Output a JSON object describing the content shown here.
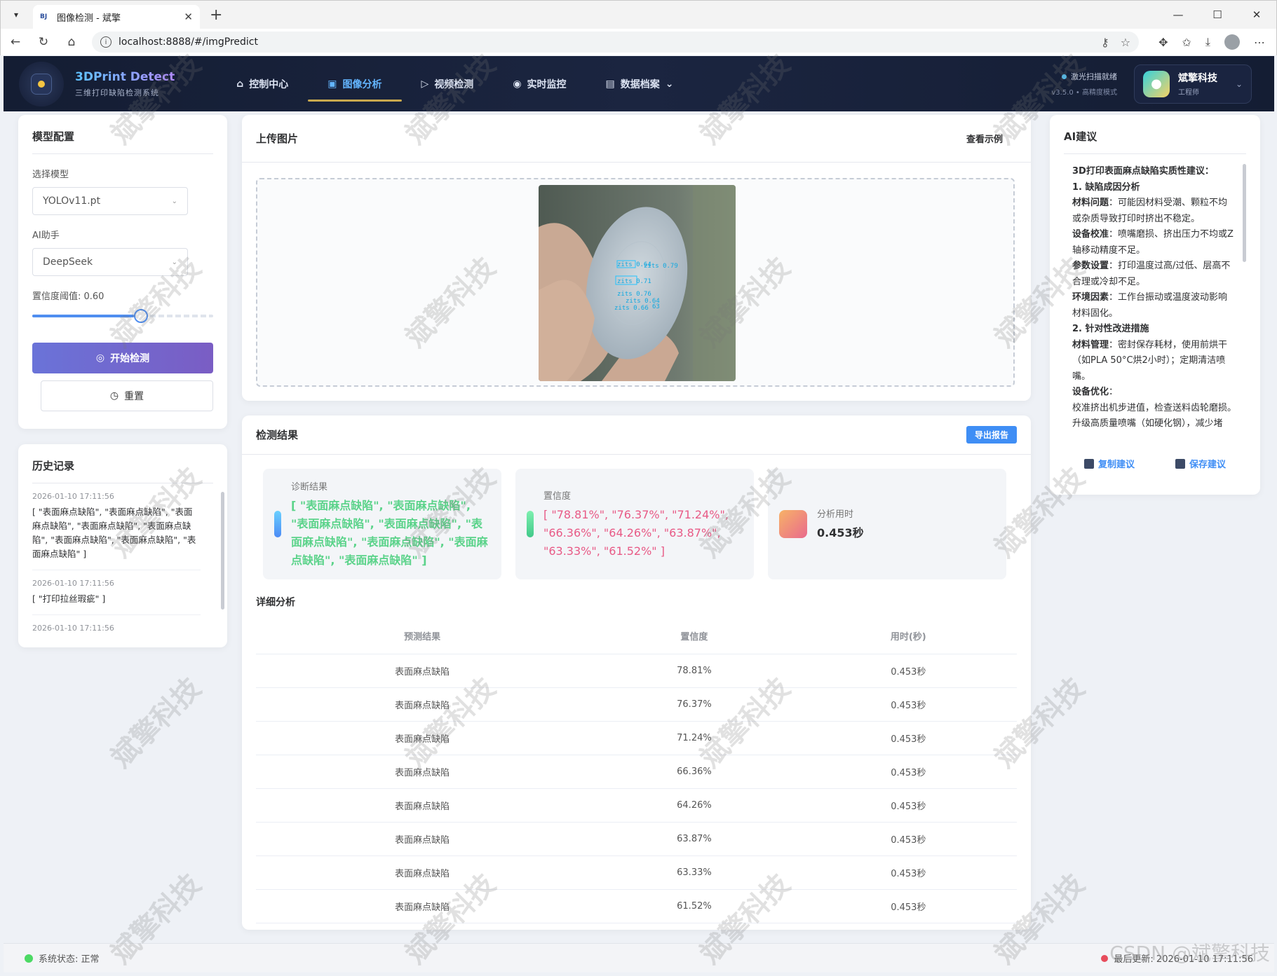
{
  "browser": {
    "tab_title": "图像检测 - 斌擎",
    "favicon": "BJ",
    "url": "localhost:8888/#/imgPredict"
  },
  "header": {
    "brand_title": "3DPrint Detect",
    "brand_sub": "三维打印缺陷检测系统",
    "nav": [
      {
        "label": "控制中心",
        "icon": "home-icon"
      },
      {
        "label": "图像分析",
        "icon": "image-icon",
        "active": true
      },
      {
        "label": "视频检测",
        "icon": "play-icon"
      },
      {
        "label": "实时监控",
        "icon": "camera-icon"
      },
      {
        "label": "数据档案",
        "icon": "document-icon"
      }
    ],
    "status_top": "激光扫描就绪",
    "status_sub": "v3.5.0 • 高精度模式",
    "user_name": "斌擎科技",
    "user_role": "工程师"
  },
  "config": {
    "title": "模型配置",
    "model_label": "选择模型",
    "model_value": "YOLOv11.pt",
    "ai_label": "AI助手",
    "ai_value": "DeepSeek",
    "threshold_label": "置信度阈值: 0.60",
    "threshold_value": 0.6,
    "start_label": "开始检测",
    "reset_label": "重置"
  },
  "history": {
    "title": "历史记录",
    "items": [
      {
        "time": "2026-01-10 17:11:56",
        "text": "[ \"表面麻点缺陷\", \"表面麻点缺陷\", \"表面麻点缺陷\", \"表面麻点缺陷\", \"表面麻点缺陷\", \"表面麻点缺陷\", \"表面麻点缺陷\", \"表面麻点缺陷\" ]"
      },
      {
        "time": "2026-01-10 17:11:56",
        "text": "[ \"打印拉丝瑕疵\" ]"
      },
      {
        "time": "2026-01-10 17:11:56",
        "text": ""
      }
    ]
  },
  "upload": {
    "title": "上传图片",
    "example_link": "查看示例",
    "detections": [
      {
        "label": "zits 0.64"
      },
      {
        "label": "zits 0.79"
      },
      {
        "label": "zits 0.71"
      },
      {
        "label": "zits 0.76"
      },
      {
        "label": "zits 0.64"
      },
      {
        "label": "zits 0.66"
      },
      {
        "label": "63"
      }
    ]
  },
  "results": {
    "title": "检测结果",
    "export_label": "导出报告",
    "diagnosis_label": "诊断结果",
    "diagnosis_value": "[ \"表面麻点缺陷\", \"表面麻点缺陷\", \"表面麻点缺陷\", \"表面麻点缺陷\", \"表面麻点缺陷\", \"表面麻点缺陷\", \"表面麻点缺陷\", \"表面麻点缺陷\" ]",
    "confidence_label": "置信度",
    "confidence_value": "[ \"78.81%\", \"76.37%\", \"71.24%\", \"66.36%\", \"64.26%\", \"63.87%\", \"63.33%\", \"61.52%\" ]",
    "time_label": "分析用时",
    "time_value": "0.453秒",
    "detail_title": "详细分析",
    "columns": [
      "预测结果",
      "置信度",
      "用时(秒)"
    ],
    "rows": [
      [
        "表面麻点缺陷",
        "78.81%",
        "0.453秒"
      ],
      [
        "表面麻点缺陷",
        "76.37%",
        "0.453秒"
      ],
      [
        "表面麻点缺陷",
        "71.24%",
        "0.453秒"
      ],
      [
        "表面麻点缺陷",
        "66.36%",
        "0.453秒"
      ],
      [
        "表面麻点缺陷",
        "64.26%",
        "0.453秒"
      ],
      [
        "表面麻点缺陷",
        "63.87%",
        "0.453秒"
      ],
      [
        "表面麻点缺陷",
        "63.33%",
        "0.453秒"
      ],
      [
        "表面麻点缺陷",
        "61.52%",
        "0.453秒"
      ]
    ]
  },
  "ai": {
    "title": "AI建议",
    "lines": [
      {
        "bold": "3D打印表面麻点缺陷实质性建议：",
        "text": ""
      },
      {
        "bold": "1. 缺陷成因分析",
        "text": ""
      },
      {
        "bold": "材料问题",
        "text": "：可能因材料受潮、颗粒不均或杂质导致打印时挤出不稳定。"
      },
      {
        "bold": "设备校准",
        "text": "：喷嘴磨损、挤出压力不均或Z轴移动精度不足。"
      },
      {
        "bold": "参数设置",
        "text": "：打印温度过高/过低、层高不合理或冷却不足。"
      },
      {
        "bold": "环境因素",
        "text": "：工作台振动或温度波动影响材料固化。"
      },
      {
        "bold": "2. 针对性改进措施",
        "text": ""
      },
      {
        "bold": "材料管理",
        "text": "：密封保存耗材，使用前烘干（如PLA 50°C烘2小时）；定期清洁喷嘴。"
      },
      {
        "bold": "设备优化",
        "text": "："
      },
      {
        "bold": "",
        "text": "校准挤出机步进值，检查送料齿轮磨损。"
      },
      {
        "bold": "",
        "text": "升级高质量喷嘴（如硬化钢），减少堵"
      }
    ],
    "copy_label": "复制建议",
    "save_label": "保存建议"
  },
  "footer": {
    "status": "系统状态: 正常",
    "updated": "最后更新: 2026-01-10 17:11:56"
  },
  "watermark": {
    "text": "斌擎科技",
    "csdn": "CSDN @斌擎科技"
  }
}
